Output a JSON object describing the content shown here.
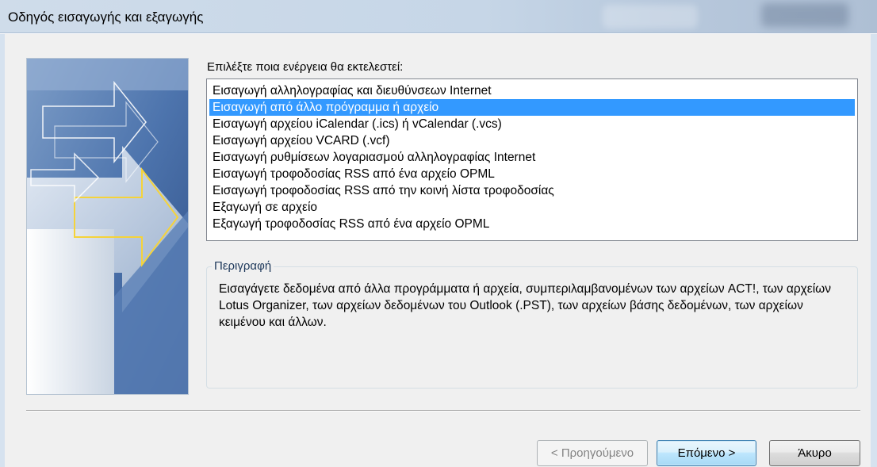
{
  "window": {
    "title": "Οδηγός εισαγωγής και εξαγωγής"
  },
  "prompt": "Επιλέξτε ποια ενέργεια θα εκτελεστεί:",
  "actions": [
    {
      "label": "Εισαγωγή αλληλογραφίας και διευθύνσεων Internet",
      "selected": false
    },
    {
      "label": "Εισαγωγή από άλλο πρόγραμμα ή αρχείο",
      "selected": true
    },
    {
      "label": "Εισαγωγή αρχείου iCalendar (.ics) ή vCalendar (.vcs)",
      "selected": false
    },
    {
      "label": "Εισαγωγή αρχείου VCARD (.vcf)",
      "selected": false
    },
    {
      "label": "Εισαγωγή ρυθμίσεων λογαριασμού αλληλογραφίας Internet",
      "selected": false
    },
    {
      "label": "Εισαγωγή τροφοδοσίας RSS από ένα αρχείο OPML",
      "selected": false
    },
    {
      "label": "Εισαγωγή τροφοδοσίας RSS από την κοινή λίστα τροφοδοσίας",
      "selected": false
    },
    {
      "label": "Εξαγωγή σε αρχείο",
      "selected": false
    },
    {
      "label": "Εξαγωγή τροφοδοσίας RSS από ένα αρχείο OPML",
      "selected": false
    }
  ],
  "description": {
    "legend": "Περιγραφή",
    "text": "Εισαγάγετε δεδομένα από άλλα προγράμματα ή αρχεία, συμπεριλαμβανομένων των αρχείων ACT!, των αρχείων Lotus Organizer, των αρχείων δεδομένων του Outlook (.PST), των αρχείων βάσης δεδομένων, των αρχείων κειμένου και άλλων."
  },
  "buttons": {
    "back": {
      "label": "< Προηγούμενο",
      "enabled": false
    },
    "next": {
      "label": "Επόμενο >",
      "enabled": true
    },
    "cancel": {
      "label": "Άκυρο",
      "enabled": true
    }
  },
  "colors": {
    "selection": "#3399ff",
    "arrow_accent": "#f5d33a"
  }
}
